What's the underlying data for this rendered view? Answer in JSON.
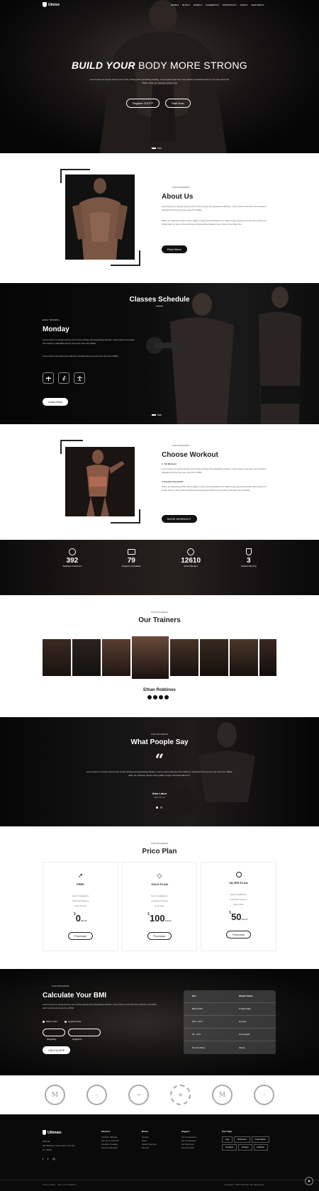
{
  "nav": {
    "brand": "Ulmize",
    "items": [
      "HOME ▾",
      "BLOG ▾",
      "PAGES ▾",
      "ELEMENTS ▾",
      "PORTFOLIO ▾",
      "SHOP ▾",
      "FEATURES ▾"
    ]
  },
  "hero": {
    "title_bold": "BUILD YOUR",
    "title_light": "BODY MORE STRONG",
    "text": "Lorem Ipsum is simply dummy text of the printing and typesetting industry. Lorem Ipsum has been the industry's standard dummy text ever since the 1500s, when an unknown printer took",
    "btn1": "Register 2019™",
    "btn2": "Start Now"
  },
  "about": {
    "eyebrow": "OUR PROGRESS",
    "title": "About Us",
    "p1": "Lorem Ipsum is simply dummy text of the printing and typesetting industry. Lorem Ipsum has been the industry's standard dummy text ever since the 1500s.",
    "p2": "When an unknown printer took a galley of type and scrambled it to make a type specimen book Lorem Ipsum is simply dummy text of the printing and typesetting industry Lorem Ipsum has been the.",
    "btn": "Read More"
  },
  "classes": {
    "title": "Classes Schedule",
    "eyebrow": "■ DAY TRAINING",
    "day": "Monday",
    "p1": "Lorem Ipsum is simply dummy text of the printing and typesetting industry. Lorem Ipsum has been the industry's standard dummy text ever since the 1500s.",
    "p2": "Lorem Ipsum has been the industry's standard dummy text ever since the 1500s.",
    "btn": "Learn More"
  },
  "workout": {
    "eyebrow": "OUR PROGRESS",
    "title": "Choose Workout",
    "s1": "1. Trx Workout",
    "s1text": "Lorem Ipsum is simply dummy text of the printing and typesetting industry. Lorem Ipsum has been the industry's standard dummy text ever since the 1500s.",
    "s2": "2. Posture Correction",
    "s2text": "When an unknown printer took a galley of type and scrambled it to make a type specimen book Lorem Ipsum is simply dummy text of the printing and typesetting industry Lorem Ipsum has been the industry.",
    "btn": "BOOK WORKOUT"
  },
  "stats": [
    {
      "value": "392",
      "label": "Satisfied Customers"
    },
    {
      "value": "79",
      "label": "Projects Completed"
    },
    {
      "value": "12610",
      "label": "Hours Worked"
    },
    {
      "value": "3",
      "label": "Awards Winning"
    }
  ],
  "trainers": {
    "eyebrow": "OUR PROGRESS",
    "title": "Our Trainers",
    "name": "Ethan Robbines"
  },
  "testimonial": {
    "eyebrow": "OUR PROGRESS",
    "title": "What Poople Say",
    "text": "Lorem Ipsum is simply dummy text of the printing and typesetting industry. Lorem Ipsum has been the industry's standard dummy text ever since the 1500s, when an unknown printer took a galley of type and scrambled it to.",
    "name": "Alan Lakor",
    "role": "CEO OF XC"
  },
  "pricing": {
    "eyebrow": "OUR PROGRESS",
    "title": "Prico Plan",
    "plans": [
      {
        "name": "FREE",
        "features": [
          "Easy Installations",
          "Unlimited Support",
          "Free Forever"
        ],
        "currency": "$",
        "price": "0",
        "per": "/Month",
        "btn": "Purchase"
      },
      {
        "name": "GOLD PLAN",
        "features": [
          "Easy Installations",
          "Unlimited Support",
          "Code Plan"
        ],
        "currency": "$",
        "price": "100",
        "per": "/Month",
        "btn": "Purchase"
      },
      {
        "name": "SILVER PLAN",
        "features": [
          "Easy Installations",
          "Unlimited Support",
          "Silver Plan"
        ],
        "currency": "$",
        "price": "50",
        "per": "/Month",
        "btn": "Purchase"
      }
    ]
  },
  "bmi": {
    "eyebrow": "OUR PROGRESS",
    "title": "Calculate Your BMI",
    "text": "Lorem Ipsum is simply dummy text of the printing and typesetting industry. Lorem Ipsum has been the industry's standard dummy text ever since the 1500s.",
    "radio1": "Metric Units",
    "radio2": "Imperial Units",
    "weight_placeholder": "Weight/kg",
    "height_placeholder": "Height/Cm",
    "btn": "CALCULATE",
    "table_head": [
      "Bmi",
      "Weight Status"
    ],
    "rows": [
      [
        "Below 18.5",
        "Underweight"
      ],
      [
        "18.5 - 24.9",
        "Normal"
      ],
      [
        "25 - 29.9",
        "Overweight"
      ],
      [
        "30 and Above",
        "Obese"
      ]
    ]
  },
  "footer": {
    "brand": "Ultimate",
    "address1": "Ultimate",
    "address2": "309 Madison Street New York City",
    "address3": "NY 10001",
    "cols": [
      {
        "title": "Services",
        "items": [
          "Portfolio Website",
          "Set Up An Account",
          "Creative Creation",
          "Get Our Specials"
        ]
      },
      {
        "title": "Brand",
        "items": [
          "Chuluk",
          "Zoom",
          "Apollo Payment",
          "Upwork"
        ]
      },
      {
        "title": "Support",
        "items": [
          "For Freelancers",
          "For Companies",
          "For Business",
          "General Help"
        ]
      }
    ],
    "tags_title": "Post Tags",
    "tags": [
      "App",
      "Business",
      "Corporation",
      "Creative",
      "Design",
      "Fashion"
    ],
    "bottom_left": "Privacy Policy  ·  Terms & Conditions",
    "bottom_right": "Copyright © 2020 Ultimate. By Themelooq"
  }
}
